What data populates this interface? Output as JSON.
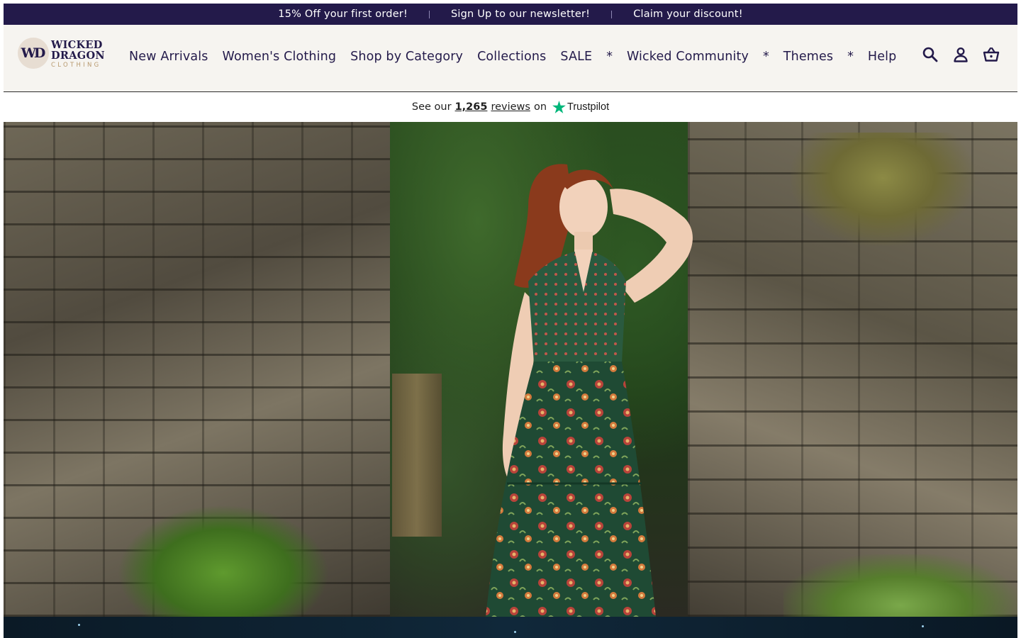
{
  "announcement": {
    "messages": [
      "15% Off your first order!",
      "Sign Up to our newsletter!",
      "Claim your discount!"
    ]
  },
  "logo": {
    "mark": "WD",
    "line1": "WICKED",
    "line2": "DRAGON",
    "line3": "CLOTHING"
  },
  "nav": {
    "items": [
      "New Arrivals",
      "Women's Clothing",
      "Shop by Category",
      "Collections",
      "SALE",
      "*",
      "Wicked Community",
      "*",
      "Themes",
      "*",
      "Help"
    ]
  },
  "header_icons": {
    "search": "search-icon",
    "account": "account-icon",
    "cart": "basket-icon"
  },
  "trustpilot": {
    "prefix": "See our",
    "count": "1,265",
    "reviews": "reviews",
    "on": "on",
    "brand": "Trustpilot"
  },
  "colors": {
    "brand_purple": "#231a4a",
    "header_bg": "#f6f4f0",
    "trustpilot_green": "#00b67a"
  }
}
